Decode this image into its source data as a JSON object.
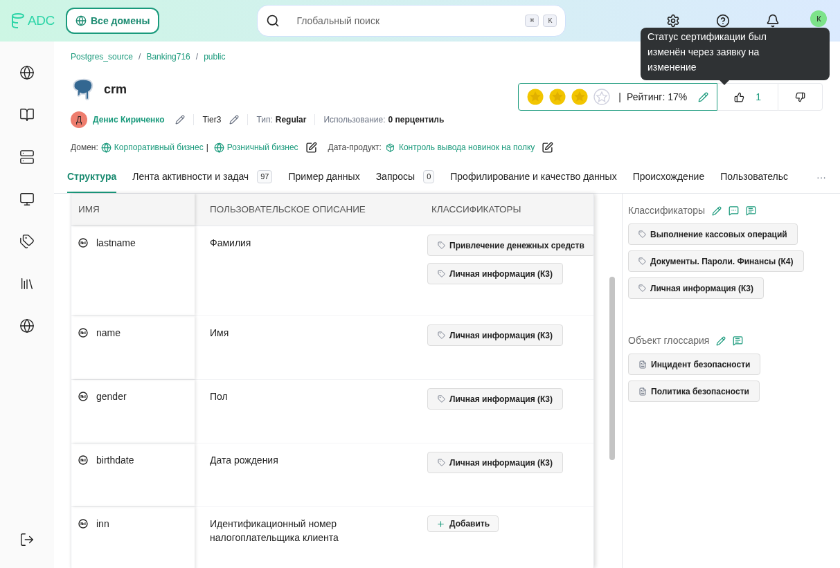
{
  "header": {
    "logo": "ADC",
    "domains_button": "Все домены",
    "search": {
      "placeholder": "Глобальный поиск",
      "shortcut": [
        "⌘",
        "K"
      ]
    },
    "avatar": "К"
  },
  "sidebar": {
    "items": [
      {
        "selected": false
      },
      {
        "selected": false
      },
      {
        "selected": false
      },
      {
        "selected": false
      },
      {
        "selected": false
      },
      {
        "selected": false
      },
      {
        "selected": false
      }
    ]
  },
  "breadcrumb": {
    "separator": "/",
    "items": [
      "Postgres_source",
      "Banking716",
      "public"
    ]
  },
  "title": "crm",
  "meta": {
    "owner_initial": "Д",
    "owner": "Денис Кириченко",
    "tier": "Tier3",
    "type_label": "Тип:",
    "type": "Regular",
    "usage_label": "Использование:",
    "usage": "0 перцентиль"
  },
  "domain": {
    "label": "Домен:",
    "items": [
      "Корпоративный бизнес",
      "Розничный бизнес"
    ],
    "separator": "|",
    "product_label": "Дата-продукт:",
    "product": "Контроль вывода новинок на полку"
  },
  "rating": {
    "stars": 3,
    "separator": "|",
    "text": "Рейтинг: 17%",
    "likes": "1"
  },
  "tooltip": "Статус сертификации был изменён через заявку на изменение",
  "tabs": [
    {
      "label": "Структура",
      "selected": true
    },
    {
      "label": "Лента активности и задач",
      "count": "97",
      "selected": false
    },
    {
      "label": "Пример данных",
      "selected": false
    },
    {
      "label": "Запросы",
      "count": "0",
      "selected": false
    },
    {
      "label": "Профилирование и качество данных",
      "selected": false
    },
    {
      "label": "Происхождение",
      "selected": false
    },
    {
      "label": "Пользовательс",
      "selected": false
    }
  ],
  "tabs_more": "···",
  "table": {
    "columns": [
      "ИМЯ",
      "ПОЛЬЗОВАТЕЛЬСКОЕ ОПИСАНИЕ",
      "КЛАССИФИКАТОРЫ"
    ],
    "rows": [
      {
        "name": "lastname",
        "description": "Фамилия",
        "tags": [
          "Привлечение денежных средств",
          "Личная информация (К3)"
        ]
      },
      {
        "name": "name",
        "description": "Имя",
        "tags": [
          "Личная информация (К3)"
        ]
      },
      {
        "name": "gender",
        "description": "Пол",
        "tags": [
          "Личная информация (К3)"
        ]
      },
      {
        "name": "birthdate",
        "description": "Дата рождения",
        "tags": [
          "Личная информация (К3)"
        ]
      },
      {
        "name": "inn",
        "description": "Идентификационный номер налогоплательщика клиента",
        "add": "Добавить"
      }
    ]
  },
  "panel": {
    "classifiers": {
      "title": "Классификаторы",
      "items": [
        "Выполнение кассовых операций",
        "Документы. Пароли. Финансы (К4)",
        "Личная информация (К3)"
      ]
    },
    "glossary": {
      "title": "Объект глоссария",
      "items": [
        "Инцидент безопасности",
        "Политика безопасности"
      ]
    }
  }
}
